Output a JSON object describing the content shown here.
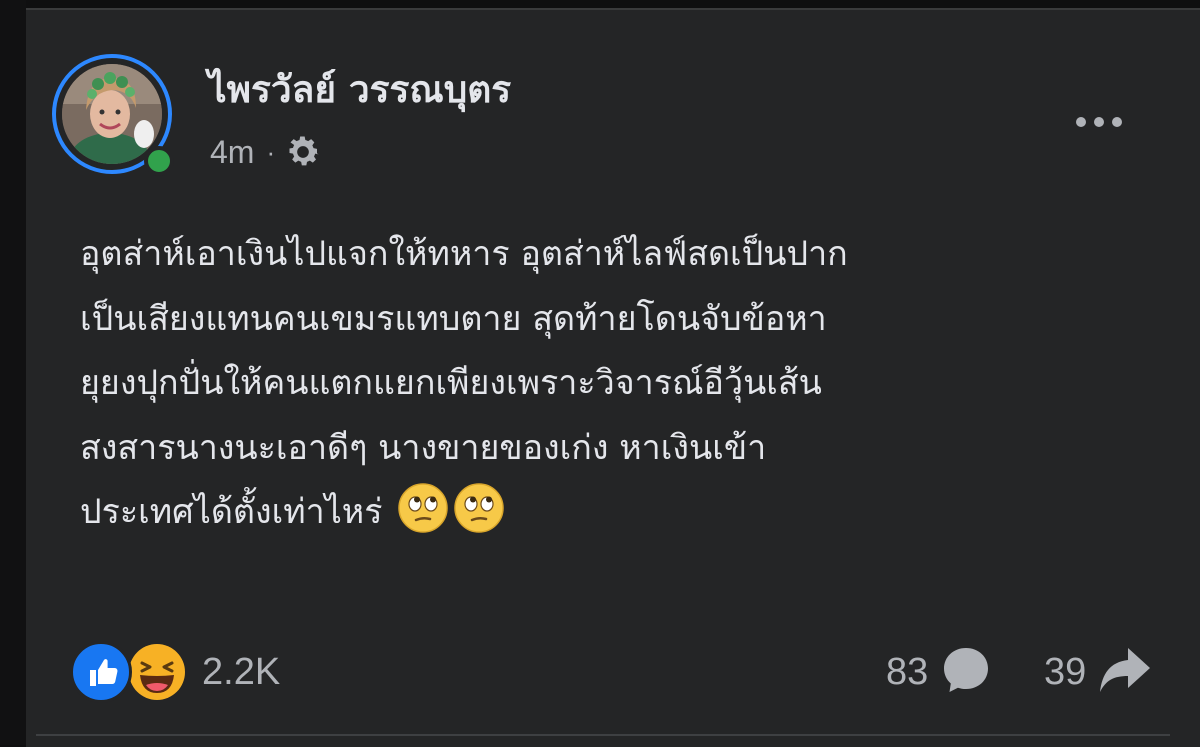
{
  "post": {
    "author_name": "ไพรวัลย์ วรรณบุตร",
    "timestamp": "4m",
    "separator": "·",
    "privacy_icon": "gear-icon",
    "author_online": true,
    "more_icon": "more-horizontal-icon",
    "text_lines": [
      "อุตส่าห์เอาเงินไปแจกให้ทหาร อุตส่าห์ไลฟ์สดเป็นปาก",
      "เป็นเสียงแทนคนเขมรแทบตาย สุดท้ายโดนจับข้อหา",
      "ยุยงปุกปั่นให้คนแตกแยกเพียงเพราะวิจารณ์อีวุ้นเส้น",
      "สงสารนางนะเอาดีๆ นางขายของเก่ง หาเงินเข้า",
      "ประเทศได้ตั้งเท่าไหร่"
    ],
    "inline_emojis": [
      "face-with-rolling-eyes-icon",
      "face-with-rolling-eyes-icon"
    ]
  },
  "footer": {
    "reaction_icons": [
      "like-icon",
      "haha-icon"
    ],
    "reaction_count": "2.2K",
    "comment_count": "83",
    "comment_icon": "comment-icon",
    "share_count": "39",
    "share_icon": "share-icon"
  },
  "colors": {
    "card_background": "#242526",
    "primary_text": "#e4e6eb",
    "secondary_text": "#b0b3b8",
    "accent_blue": "#1877f2",
    "online_green": "#31a24c"
  }
}
